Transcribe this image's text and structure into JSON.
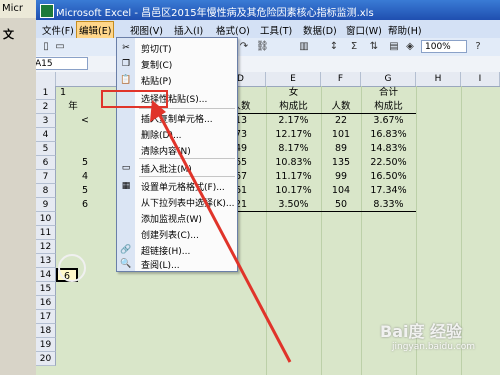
{
  "outer_window": {
    "title": "Micr",
    "menu_fragment": "文"
  },
  "window": {
    "title": "Microsoft Excel - 昌邑区2015年慢性病及其危险因素核心指标监测.xls"
  },
  "menubar": [
    "文件(F)",
    "编辑(E)",
    "视图(V)",
    "插入(I)",
    "格式(O)",
    "工具(T)",
    "数据(D)",
    "窗口(W)",
    "帮助(H)"
  ],
  "active_menu": "编辑(E)",
  "toolbar": {
    "zoom": "100%"
  },
  "namebox": "A15",
  "columns": [
    "D",
    "E",
    "F",
    "G",
    "H",
    "I"
  ],
  "rows": [
    "1",
    "2",
    "3",
    "4",
    "5",
    "6",
    "7",
    "8",
    "9",
    "10",
    "11",
    "12",
    "13",
    "14",
    "15",
    "16",
    "17",
    "18",
    "19",
    "20"
  ],
  "sheet": {
    "header1": {
      "female": "女",
      "total": "合计"
    },
    "header2": [
      "人数",
      "构成比",
      "人数",
      "构成比"
    ],
    "body": [
      [
        "13",
        "2.17%",
        "22",
        "3.67%"
      ],
      [
        "73",
        "12.17%",
        "101",
        "16.83%"
      ],
      [
        "49",
        "8.17%",
        "89",
        "14.83%"
      ],
      [
        "65",
        "10.83%",
        "135",
        "22.50%"
      ],
      [
        "67",
        "11.17%",
        "99",
        "16.50%"
      ],
      [
        "61",
        "10.17%",
        "104",
        "17.34%"
      ],
      [
        "21",
        "3.50%",
        "50",
        "8.33%"
      ]
    ],
    "col_b_fragment": [
      "年",
      "<",
      "5",
      "4",
      "5",
      "6"
    ],
    "selected_cell_value": "6"
  },
  "context_menu": {
    "items": [
      {
        "label": "剪切(T)",
        "icon": "scissors-icon",
        "glyph": "✂"
      },
      {
        "label": "复制(C)",
        "icon": "copy-icon",
        "glyph": "❐"
      },
      {
        "label": "粘贴(P)",
        "icon": "paste-icon",
        "glyph": "📋"
      },
      {
        "label": "选择性粘贴(S)...",
        "icon": "",
        "glyph": ""
      },
      {
        "label": "插入复制单元格...",
        "icon": "",
        "glyph": ""
      },
      {
        "label": "删除(D)...",
        "icon": "",
        "glyph": ""
      },
      {
        "label": "清除内容(N)",
        "icon": "",
        "glyph": ""
      },
      {
        "label": "插入批注(M)",
        "icon": "comment-icon",
        "glyph": "▭"
      },
      {
        "label": "设置单元格格式(F)...",
        "icon": "format-cells-icon",
        "glyph": "▦"
      },
      {
        "label": "从下拉列表中选择(K)...",
        "icon": "",
        "glyph": ""
      },
      {
        "label": "添加监视点(W)",
        "icon": "",
        "glyph": ""
      },
      {
        "label": "创建列表(C)...",
        "icon": "",
        "glyph": ""
      },
      {
        "label": "超链接(H)...",
        "icon": "hyperlink-icon",
        "glyph": "🔗"
      },
      {
        "label": "查阅(L)...",
        "icon": "lookup-icon",
        "glyph": "🔍"
      }
    ],
    "highlighted": "选择性粘贴(S)..."
  },
  "watermark": {
    "brand": "Bai度 经验",
    "url": "jingyan.baidu.com"
  },
  "colors": {
    "highlight_red": "#e0342a",
    "grid_bg": "#d9e6c9",
    "title_blue": "#1f4fb0"
  }
}
